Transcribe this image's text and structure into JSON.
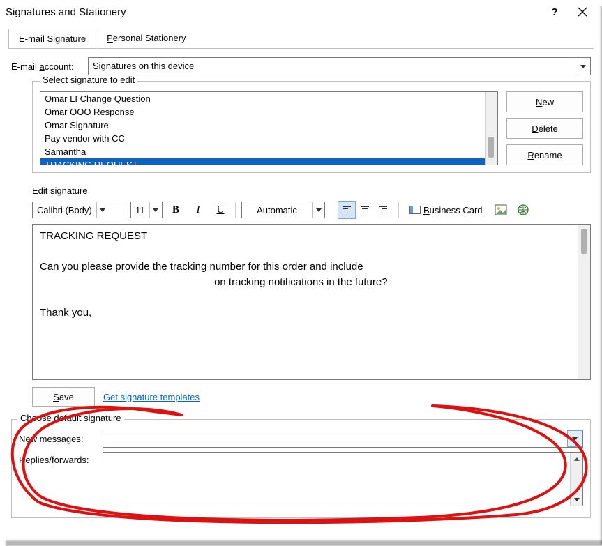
{
  "titlebar": {
    "title": "Signatures and Stationery"
  },
  "tabs": {
    "email_sig": "E-mail Signature",
    "personal": "Personal Stationery"
  },
  "account": {
    "label": "E-mail account:",
    "value": "Signatures on this device"
  },
  "select_group": {
    "legend": "Select signature to edit"
  },
  "signatures": [
    "Omar LI Change Question",
    "Omar OOO Response",
    "Omar Signature",
    "Pay vendor with CC",
    "Samantha",
    "TRACKING REQUEST"
  ],
  "selected_index": 5,
  "buttons": {
    "new": "New",
    "delete": "Delete",
    "rename": "Rename",
    "save": "Save"
  },
  "edit_label": "Edit signature",
  "toolbar": {
    "font": "Calibri (Body)",
    "size": "11",
    "color": "Automatic",
    "bizcard": "Business Card"
  },
  "editor_text": "TRACKING REQUEST\n\nCan you please provide the tracking number for this order and include\n                                                            on tracking notifications in the future?\n\nThank you,",
  "templates_link": "Get signature templates",
  "defaults": {
    "legend": "Choose default signature",
    "new_msg": "New messages:",
    "new_msg_value": "",
    "replies": "Replies/forwards:"
  }
}
